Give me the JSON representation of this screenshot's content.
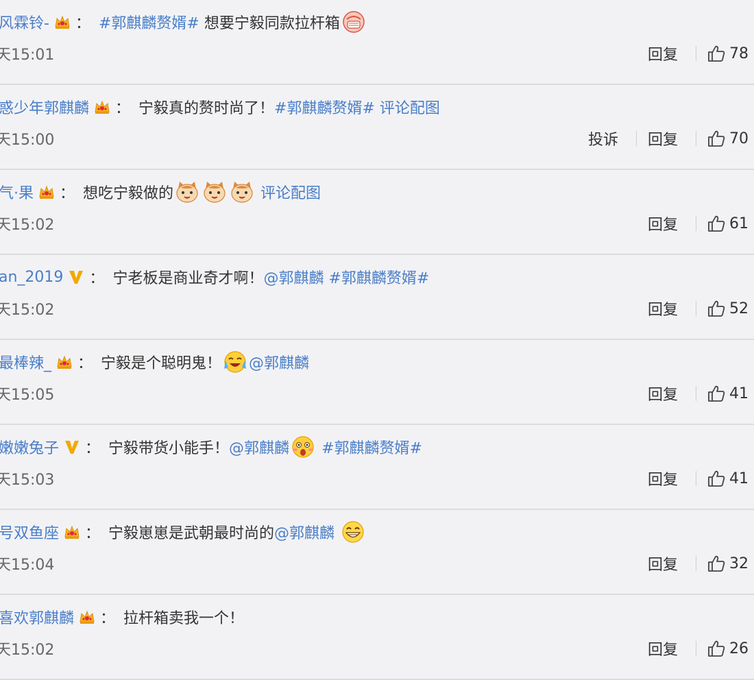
{
  "comments": [
    {
      "user": "风霖铃-",
      "badge": "crown",
      "segments": [
        {
          "t": "link",
          "v": "#郭麒麟赘婿#"
        },
        {
          "t": "text",
          "v": " 想要宁毅同款拉杆箱"
        },
        {
          "t": "emoji",
          "v": "face-mask-emoji"
        }
      ],
      "time": "天15:01",
      "complaint": "",
      "reply": "回复",
      "likes": "78"
    },
    {
      "user": "惑少年郭麒麟",
      "badge": "crown",
      "segments": [
        {
          "t": "text",
          "v": "宁毅真的赘时尚了！"
        },
        {
          "t": "link",
          "v": "#郭麒麟赘婿#"
        },
        {
          "t": "text",
          "v": " "
        },
        {
          "t": "link",
          "v": "评论配图"
        }
      ],
      "time": "天15:00",
      "complaint": "投诉",
      "reply": "回复",
      "likes": "70"
    },
    {
      "user": "气·果",
      "badge": "crown",
      "segments": [
        {
          "t": "text",
          "v": "想吃宁毅做的"
        },
        {
          "t": "emoji",
          "v": "cat-face-emoji"
        },
        {
          "t": "emoji",
          "v": "cat-face-emoji"
        },
        {
          "t": "emoji",
          "v": "cat-face-emoji"
        },
        {
          "t": "text",
          "v": " "
        },
        {
          "t": "link",
          "v": "评论配图"
        }
      ],
      "time": "天15:02",
      "complaint": "",
      "reply": "回复",
      "likes": "61"
    },
    {
      "user": "an_2019",
      "badge": "v",
      "segments": [
        {
          "t": "text",
          "v": "宁老板是商业奇才啊！"
        },
        {
          "t": "link",
          "v": "@郭麒麟"
        },
        {
          "t": "text",
          "v": " "
        },
        {
          "t": "link",
          "v": "#郭麒麟赘婿#"
        }
      ],
      "time": "天15:02",
      "complaint": "",
      "reply": "回复",
      "likes": "52"
    },
    {
      "user": "最棒辣_",
      "badge": "crown",
      "segments": [
        {
          "t": "text",
          "v": "宁毅是个聪明鬼！"
        },
        {
          "t": "emoji",
          "v": "crying-laughing-emoji"
        },
        {
          "t": "link",
          "v": "@郭麒麟"
        }
      ],
      "time": "天15:05",
      "complaint": "",
      "reply": "回复",
      "likes": "41"
    },
    {
      "user": "嫩嫩兔子",
      "badge": "v",
      "segments": [
        {
          "t": "text",
          "v": "宁毅带货小能手！"
        },
        {
          "t": "link",
          "v": "@郭麒麟"
        },
        {
          "t": "emoji",
          "v": "shocked-face-emoji"
        },
        {
          "t": "text",
          "v": " "
        },
        {
          "t": "link",
          "v": "#郭麒麟赘婿#"
        }
      ],
      "time": "天15:03",
      "complaint": "",
      "reply": "回复",
      "likes": "41"
    },
    {
      "user": "号双鱼座",
      "badge": "crown",
      "segments": [
        {
          "t": "text",
          "v": "宁毅崽崽是武朝最时尚的"
        },
        {
          "t": "link",
          "v": "@郭麒麟"
        },
        {
          "t": "text",
          "v": " "
        },
        {
          "t": "emoji",
          "v": "grinning-face-emoji"
        }
      ],
      "time": "天15:04",
      "complaint": "",
      "reply": "回复",
      "likes": "32"
    },
    {
      "user": "喜欢郭麒麟",
      "badge": "crown",
      "segments": [
        {
          "t": "text",
          "v": "拉杆箱卖我一个！"
        }
      ],
      "time": "天15:02",
      "complaint": "",
      "reply": "回复",
      "likes": "26"
    }
  ],
  "colon": "：",
  "colors": {
    "link": "#4a7ec7",
    "text": "#333333",
    "time": "#666666",
    "bg": "#f2f2f5"
  }
}
